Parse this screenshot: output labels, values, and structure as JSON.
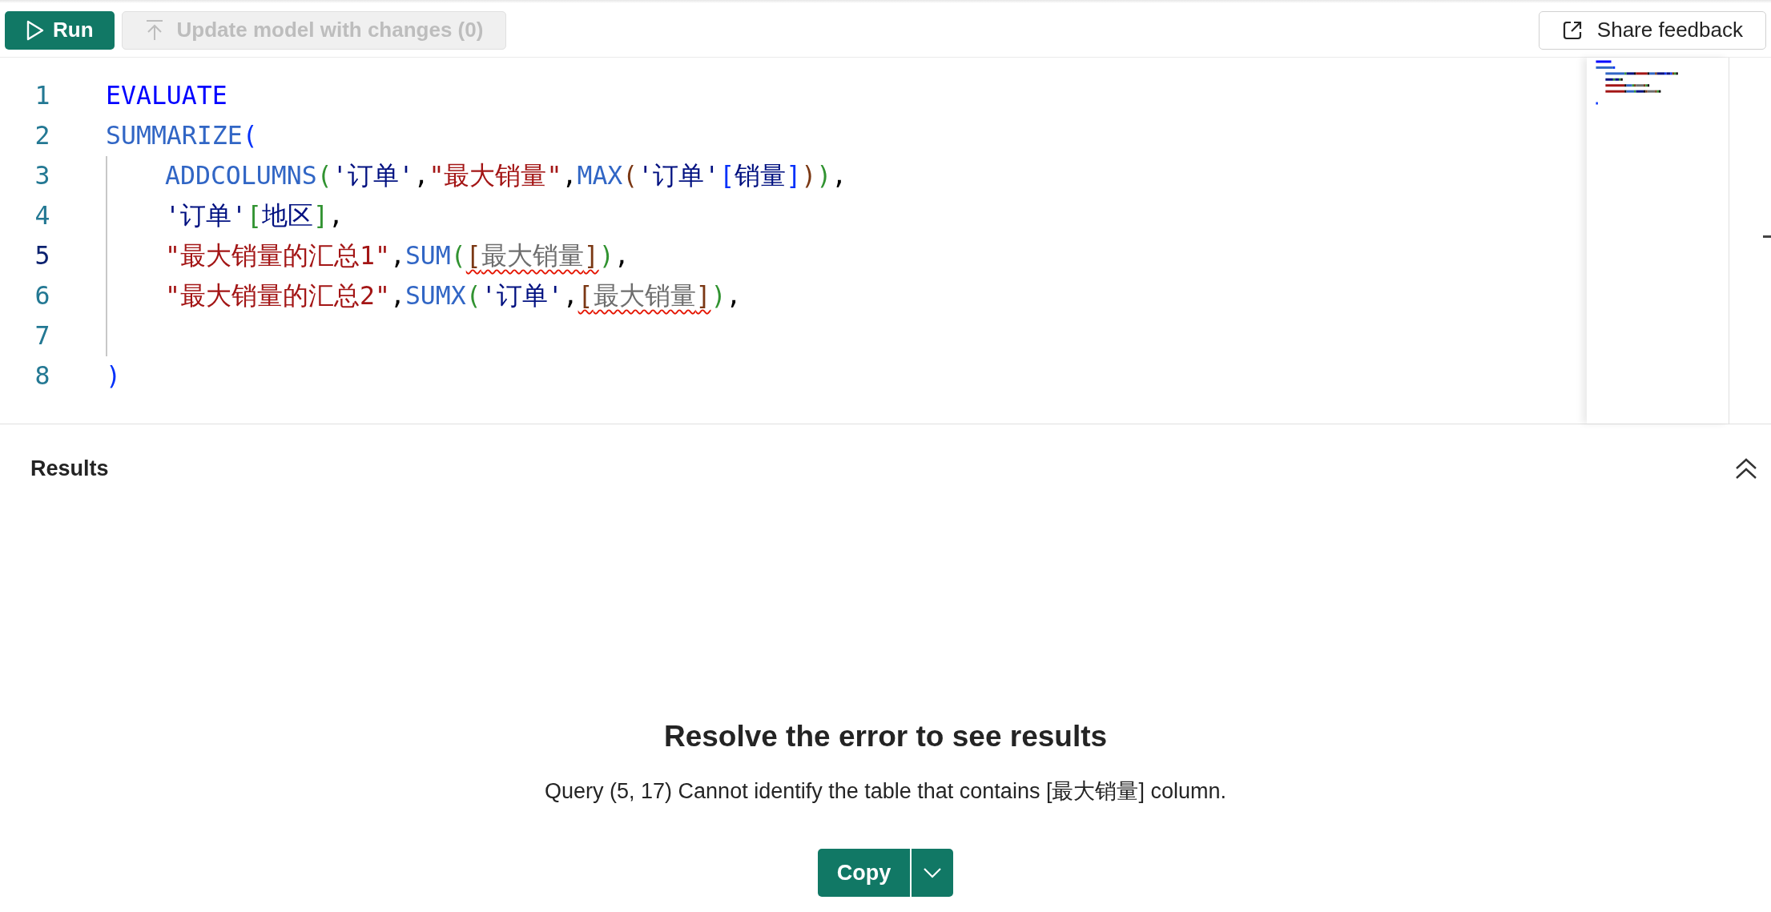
{
  "toolbar": {
    "run_button": {
      "label": "Run",
      "disabled": false
    },
    "update_button": {
      "label": "Update model with changes (0)",
      "disabled": true
    },
    "feedback_button": {
      "label": "Share feedback"
    }
  },
  "editor": {
    "lines": [
      {
        "number": "1",
        "current": false,
        "indented": false,
        "tokens": [
          {
            "text": "EVALUATE",
            "color": "#0000ff",
            "error": false
          }
        ]
      },
      {
        "number": "2",
        "current": false,
        "indented": false,
        "tokens": [
          {
            "text": "SUMMARIZE",
            "color": "#3166c5",
            "error": false
          },
          {
            "text": "(",
            "color": "#0431fa",
            "error": false
          }
        ]
      },
      {
        "number": "3",
        "current": false,
        "indented": true,
        "tokens": [
          {
            "text": "ADDCOLUMNS",
            "color": "#3166c5",
            "error": false
          },
          {
            "text": "(",
            "color": "#319331",
            "error": false
          },
          {
            "text": "'订单'",
            "color": "#001080",
            "error": false
          },
          {
            "text": ",",
            "color": "#000000",
            "error": false
          },
          {
            "text": "\"最大销量\"",
            "color": "#a31515",
            "error": false
          },
          {
            "text": ",",
            "color": "#000000",
            "error": false
          },
          {
            "text": "MAX",
            "color": "#3166c5",
            "error": false
          },
          {
            "text": "(",
            "color": "#7b3814",
            "error": false
          },
          {
            "text": "'订单'",
            "color": "#001080",
            "error": false
          },
          {
            "text": "[",
            "color": "#0431fa",
            "error": false
          },
          {
            "text": "销量",
            "color": "#001080",
            "error": false
          },
          {
            "text": "]",
            "color": "#0431fa",
            "error": false
          },
          {
            "text": ")",
            "color": "#7b3814",
            "error": false
          },
          {
            "text": ")",
            "color": "#319331",
            "error": false
          },
          {
            "text": ",",
            "color": "#000000",
            "error": false
          }
        ]
      },
      {
        "number": "4",
        "current": false,
        "indented": true,
        "tokens": [
          {
            "text": "'订单'",
            "color": "#001080",
            "error": false
          },
          {
            "text": "[",
            "color": "#319331",
            "error": false
          },
          {
            "text": "地区",
            "color": "#001080",
            "error": false
          },
          {
            "text": "]",
            "color": "#319331",
            "error": false
          },
          {
            "text": ",",
            "color": "#000000",
            "error": false
          }
        ]
      },
      {
        "number": "5",
        "current": true,
        "indented": true,
        "tokens": [
          {
            "text": "\"最大销量的汇总1\"",
            "color": "#a31515",
            "error": false
          },
          {
            "text": ",",
            "color": "#000000",
            "error": false
          },
          {
            "text": "SUM",
            "color": "#3166c5",
            "error": false
          },
          {
            "text": "(",
            "color": "#319331",
            "error": false
          },
          {
            "text": "[",
            "color": "#7b3814",
            "error": true
          },
          {
            "text": "最大销量",
            "color": "#6e6e6e",
            "error": true
          },
          {
            "text": "]",
            "color": "#7b3814",
            "error": true
          },
          {
            "text": ")",
            "color": "#319331",
            "error": false
          },
          {
            "text": ",",
            "color": "#000000",
            "error": false
          }
        ]
      },
      {
        "number": "6",
        "current": false,
        "indented": true,
        "tokens": [
          {
            "text": "\"最大销量的汇总2\"",
            "color": "#a31515",
            "error": false
          },
          {
            "text": ",",
            "color": "#000000",
            "error": false
          },
          {
            "text": "SUMX",
            "color": "#3166c5",
            "error": false
          },
          {
            "text": "(",
            "color": "#319331",
            "error": false
          },
          {
            "text": "'订单'",
            "color": "#001080",
            "error": false
          },
          {
            "text": ",",
            "color": "#000000",
            "error": false
          },
          {
            "text": "[",
            "color": "#7b3814",
            "error": true
          },
          {
            "text": "最大销量",
            "color": "#6e6e6e",
            "error": true
          },
          {
            "text": "]",
            "color": "#7b3814",
            "error": true
          },
          {
            "text": ")",
            "color": "#319331",
            "error": false
          },
          {
            "text": ",",
            "color": "#000000",
            "error": false
          }
        ]
      },
      {
        "number": "7",
        "current": false,
        "indented": true
      },
      {
        "number": "8",
        "current": false,
        "indented": false,
        "tokens": [
          {
            "text": ")",
            "color": "#0431fa",
            "error": false
          }
        ]
      }
    ]
  },
  "results": {
    "title": "Results",
    "expanded": true,
    "heading": "Resolve the error to see results",
    "message": "Query (5, 17) Cannot identify the table that contains [最大销量] column.",
    "copy_button": "Copy"
  }
}
